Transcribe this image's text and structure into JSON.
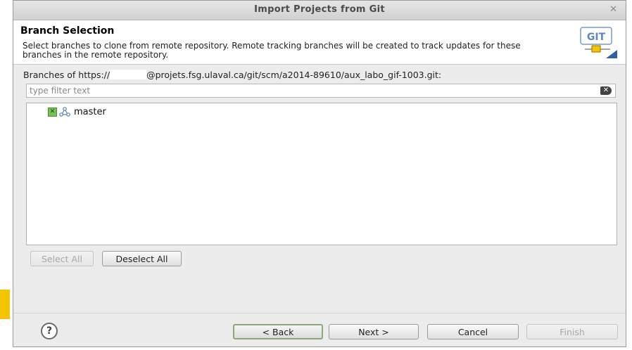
{
  "window": {
    "title": "Import Projects from Git"
  },
  "banner": {
    "title": "Branch Selection",
    "description": "Select branches to clone from remote repository. Remote tracking branches will be created to track updates for these branches in the remote repository.",
    "logo_text": "GIT"
  },
  "branches": {
    "label_prefix": "Branches of https://",
    "label_suffix": "@projets.fsg.ulaval.ca/git/scm/a2014-89610/aux_labo_gif-1003.git:",
    "filter_placeholder": "type filter text",
    "items": [
      {
        "label": "master",
        "checked": true
      }
    ]
  },
  "selection_buttons": {
    "select_all": "Select All",
    "deselect_all": "Deselect All"
  },
  "nav_buttons": {
    "back": "< Back",
    "next": "Next >",
    "cancel": "Cancel",
    "finish": "Finish"
  },
  "icons": {
    "help": "help-icon",
    "close": "close-icon",
    "clear": "clear-filter-icon",
    "branch": "branch-icon"
  },
  "colors": {
    "side_accent": "#f5c400",
    "checkbox": "#78c05a"
  }
}
